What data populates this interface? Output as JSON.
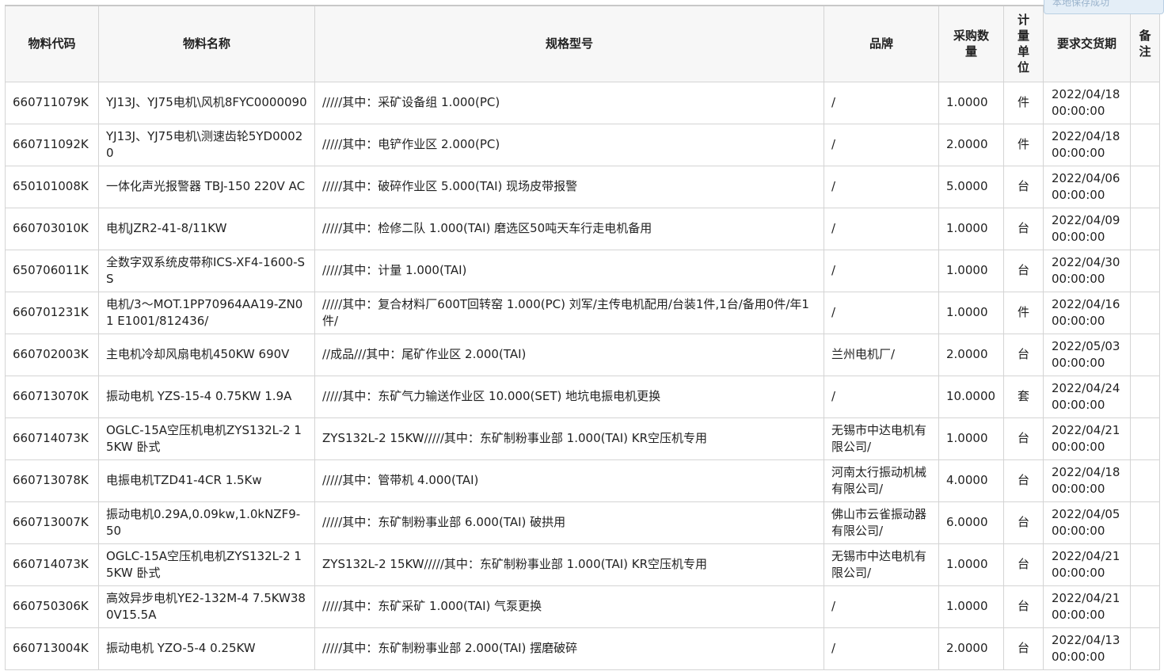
{
  "toast": {
    "text": "本地保存成功"
  },
  "table": {
    "headers": {
      "code": "物料代码",
      "name": "物料名称",
      "spec": "规格型号",
      "brand": "品牌",
      "qty": "采购数量",
      "unit": "计量单位",
      "date": "要求交货期",
      "remark": "备注"
    },
    "rows": [
      {
        "code": "660711079K",
        "name": "YJ13J、YJ75电机\\风机8FYC0000090",
        "spec": "/////其中：采矿设备组 1.000(PC)",
        "brand": "/",
        "qty": "1.0000",
        "unit": "件",
        "date": "2022/04/18 00:00:00",
        "remark": ""
      },
      {
        "code": "660711092K",
        "name": "YJ13J、YJ75电机\\测速齿轮5YD00020",
        "spec": "/////其中：电铲作业区 2.000(PC)",
        "brand": "/",
        "qty": "2.0000",
        "unit": "件",
        "date": "2022/04/18 00:00:00",
        "remark": ""
      },
      {
        "code": "650101008K",
        "name": "一体化声光报警器 TBJ-150 220V AC",
        "spec": "/////其中：破碎作业区 5.000(TAI) 现场皮带报警",
        "brand": "/",
        "qty": "5.0000",
        "unit": "台",
        "date": "2022/04/06 00:00:00",
        "remark": ""
      },
      {
        "code": "660703010K",
        "name": "电机JZR2-41-8/11KW",
        "spec": "/////其中：检修二队 1.000(TAI) 磨选区50吨天车行走电机备用",
        "brand": "/",
        "qty": "1.0000",
        "unit": "台",
        "date": "2022/04/09 00:00:00",
        "remark": ""
      },
      {
        "code": "650706011K",
        "name": "全数字双系统皮带称ICS-XF4-1600-SS",
        "spec": "/////其中：计量 1.000(TAI)",
        "brand": "/",
        "qty": "1.0000",
        "unit": "台",
        "date": "2022/04/30 00:00:00",
        "remark": ""
      },
      {
        "code": "660701231K",
        "name": "电机/3～MOT.1PP70964AA19-ZN01 E1001/812436/",
        "spec": "/////其中：复合材料厂600T回转窑 1.000(PC) 刘军/主传电机配用/台装1件,1台/备用0件/年1件/",
        "brand": "/",
        "qty": "1.0000",
        "unit": "件",
        "date": "2022/04/16 00:00:00",
        "remark": ""
      },
      {
        "code": "660702003K",
        "name": "主电机冷却风扇电机450KW 690V",
        "spec": "//成品///其中：尾矿作业区 2.000(TAI)",
        "brand": "兰州电机厂/",
        "qty": "2.0000",
        "unit": "台",
        "date": "2022/05/03 00:00:00",
        "remark": ""
      },
      {
        "code": "660713070K",
        "name": "振动电机 YZS-15-4 0.75KW 1.9A",
        "spec": "/////其中：东矿气力输送作业区 10.000(SET) 地坑电振电机更换",
        "brand": "/",
        "qty": "10.0000",
        "unit": "套",
        "date": "2022/04/24 00:00:00",
        "remark": ""
      },
      {
        "code": "660714073K",
        "name": "OGLC-15A空压机电机ZYS132L-2 15KW 卧式",
        "spec": "ZYS132L-2 15KW/////其中：东矿制粉事业部 1.000(TAI) KR空压机专用",
        "brand": "无锡市中达电机有限公司/",
        "qty": "1.0000",
        "unit": "台",
        "date": "2022/04/21 00:00:00",
        "remark": ""
      },
      {
        "code": "660713078K",
        "name": "电振电机TZD41-4CR 1.5Kw",
        "spec": "/////其中：管带机 4.000(TAI)",
        "brand": "河南太行振动机械有限公司/",
        "qty": "4.0000",
        "unit": "台",
        "date": "2022/04/18 00:00:00",
        "remark": ""
      },
      {
        "code": "660713007K",
        "name": "振动电机0.29A,0.09kw,1.0kNZF9-50",
        "spec": "/////其中：东矿制粉事业部 6.000(TAI) 破拱用",
        "brand": "佛山市云雀振动器有限公司/",
        "qty": "6.0000",
        "unit": "台",
        "date": "2022/04/05 00:00:00",
        "remark": ""
      },
      {
        "code": "660714073K",
        "name": "OGLC-15A空压机电机ZYS132L-2 15KW 卧式",
        "spec": "ZYS132L-2 15KW/////其中：东矿制粉事业部 1.000(TAI) KR空压机专用",
        "brand": "无锡市中达电机有限公司/",
        "qty": "1.0000",
        "unit": "台",
        "date": "2022/04/21 00:00:00",
        "remark": ""
      },
      {
        "code": "660750306K",
        "name": "高效异步电机YE2-132M-4 7.5KW380V15.5A",
        "spec": "/////其中：东矿采矿 1.000(TAI) 气泵更换",
        "brand": "/",
        "qty": "1.0000",
        "unit": "台",
        "date": "2022/04/21 00:00:00",
        "remark": ""
      },
      {
        "code": "660713004K",
        "name": "振动电机 YZO-5-4 0.25KW",
        "spec": "/////其中：东矿制粉事业部 2.000(TAI) 摆磨破碎",
        "brand": "/",
        "qty": "2.0000",
        "unit": "台",
        "date": "2022/04/13 00:00:00",
        "remark": ""
      }
    ]
  }
}
